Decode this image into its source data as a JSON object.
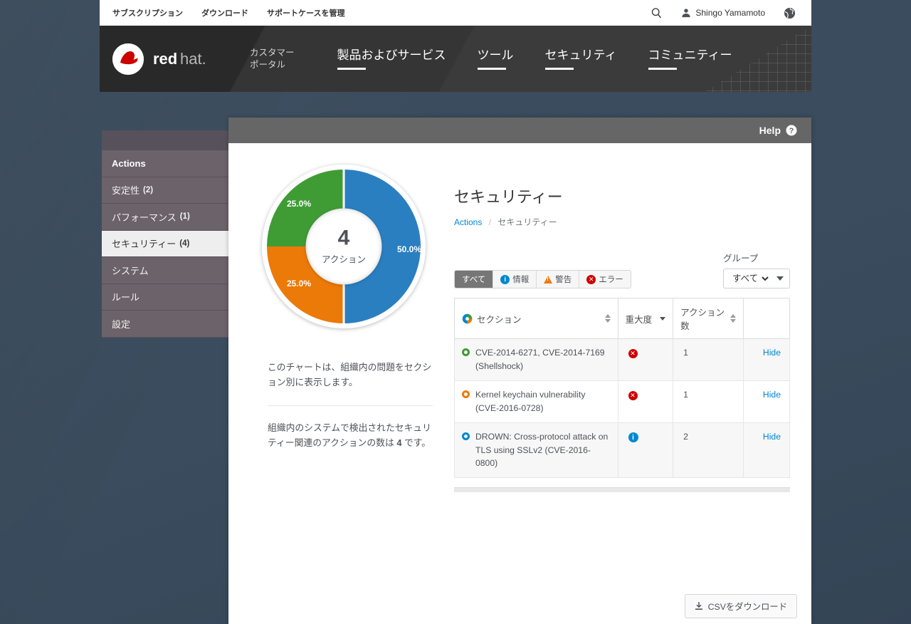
{
  "topbar": {
    "links": [
      {
        "label": "サブスクリプション"
      },
      {
        "label": "ダウンロード"
      },
      {
        "label": "サポートケースを管理"
      }
    ],
    "search_icon": "search-icon",
    "user_icon": "user-icon",
    "user_name": "Shingo Yamamoto",
    "language_icon": "globe-icon"
  },
  "masthead": {
    "logo_alt": "redhat",
    "logo_word_red": "red",
    "logo_word_grey": "hat.",
    "portal_label": "カスタマー\nポータル",
    "nav": [
      {
        "label": "製品およびサービス"
      },
      {
        "label": "ツール"
      },
      {
        "label": "セキュリティ"
      },
      {
        "label": "コミュニティー"
      }
    ]
  },
  "sidebar": {
    "items": [
      {
        "label": "Actions",
        "count": "",
        "type": "header",
        "selected": false
      },
      {
        "label": "安定性",
        "count": "(2)",
        "type": "item",
        "selected": false
      },
      {
        "label": "パフォーマンス",
        "count": "(1)",
        "type": "item",
        "selected": false
      },
      {
        "label": "セキュリティー",
        "count": "(4)",
        "type": "item",
        "selected": true
      },
      {
        "label": "システム",
        "count": "",
        "type": "item",
        "selected": false
      },
      {
        "label": "ルール",
        "count": "",
        "type": "item",
        "selected": false
      },
      {
        "label": "設定",
        "count": "",
        "type": "item",
        "selected": false
      }
    ]
  },
  "panel": {
    "help_label": "Help",
    "help_icon": "question-circle-icon"
  },
  "chart_data": {
    "type": "pie",
    "title": "",
    "center_value": "4",
    "center_label": "アクション",
    "categories": [
      "DROWN: Cross-protocol attack on TLS using SSLv2 (CVE-2016-0800)",
      "Kernel keychain vulnerability (CVE-2016-0728)",
      "CVE-2014-6271, CVE-2014-7169 (Shellshock)"
    ],
    "values": [
      50.0,
      25.0,
      25.0
    ],
    "labels": [
      "50.0%",
      "25.0%",
      "25.0%"
    ],
    "colors": [
      "#2a7fc1",
      "#ec7a08",
      "#3f9c35"
    ],
    "legend": "none",
    "total": 4
  },
  "chart_desc": {
    "paragraph1": "このチャートは、組織内の問題をセクション別に表示します。",
    "paragraph2_before": "組織内のシステムで検出されたセキュリティー関連のアクションの数は ",
    "paragraph2_number": "4",
    "paragraph2_after": " です。"
  },
  "main": {
    "page_title": "セキュリティー",
    "breadcrumb": {
      "root": "Actions",
      "separator": "/",
      "current": "セキュリティー"
    },
    "severity_filter": [
      {
        "label": "すべて",
        "icon": "none",
        "active": true
      },
      {
        "label": "情報",
        "icon": "info-icon",
        "active": false
      },
      {
        "label": "警告",
        "icon": "warning-triangle-icon",
        "active": false
      },
      {
        "label": "エラー",
        "icon": "error-icon",
        "active": false
      }
    ],
    "group": {
      "label": "グループ",
      "selected": "すべて",
      "options": [
        "すべて"
      ],
      "caret_icon": "caret-down-icon"
    },
    "table": {
      "headers": [
        {
          "label": "セクション",
          "icon": "section-pie-icon",
          "sort": "both"
        },
        {
          "label": "重大度",
          "icon": "none",
          "sort": "desc"
        },
        {
          "label": "アクション数",
          "icon": "none",
          "sort": "both"
        },
        {
          "label": "",
          "icon": "none",
          "sort": "none"
        }
      ],
      "rows": [
        {
          "ring_color": "green",
          "section": "CVE-2014-6271, CVE-2014-7169 (Shellshock)",
          "severity_icon": "error-icon",
          "count": "1",
          "action_label": "Hide"
        },
        {
          "ring_color": "orange",
          "section": "Kernel keychain vulnerability (CVE-2016-0728)",
          "severity_icon": "error-icon",
          "count": "1",
          "action_label": "Hide"
        },
        {
          "ring_color": "blue",
          "section": "DROWN: Cross-protocol attack on TLS using SSLv2 (CVE-2016-0800)",
          "severity_icon": "info-icon",
          "count": "2",
          "action_label": "Hide"
        }
      ]
    },
    "footer": {
      "csv_label": "CSVをダウンロード",
      "csv_icon": "download-icon"
    }
  },
  "colors": {
    "page_bg": "#36485a",
    "masthead": "#292929",
    "panel_header": "#666666",
    "sidebar": "#6b626a",
    "sidebar_selected": "#eeeeee",
    "link": "#0088ce",
    "green": "#3f9c35",
    "orange": "#ec7a08",
    "blue": "#2a7fc1",
    "red": "#cc0000"
  }
}
